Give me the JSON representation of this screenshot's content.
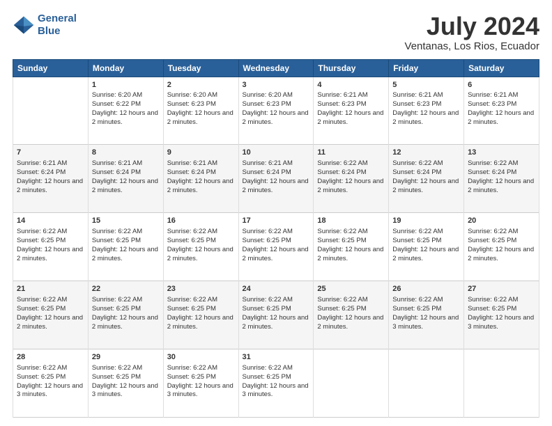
{
  "header": {
    "logo_line1": "General",
    "logo_line2": "Blue",
    "month": "July 2024",
    "location": "Ventanas, Los Rios, Ecuador"
  },
  "days_of_week": [
    "Sunday",
    "Monday",
    "Tuesday",
    "Wednesday",
    "Thursday",
    "Friday",
    "Saturday"
  ],
  "weeks": [
    [
      {
        "day": "",
        "sunrise": "",
        "sunset": "",
        "daylight": ""
      },
      {
        "day": "1",
        "sunrise": "Sunrise: 6:20 AM",
        "sunset": "Sunset: 6:22 PM",
        "daylight": "Daylight: 12 hours and 2 minutes."
      },
      {
        "day": "2",
        "sunrise": "Sunrise: 6:20 AM",
        "sunset": "Sunset: 6:23 PM",
        "daylight": "Daylight: 12 hours and 2 minutes."
      },
      {
        "day": "3",
        "sunrise": "Sunrise: 6:20 AM",
        "sunset": "Sunset: 6:23 PM",
        "daylight": "Daylight: 12 hours and 2 minutes."
      },
      {
        "day": "4",
        "sunrise": "Sunrise: 6:21 AM",
        "sunset": "Sunset: 6:23 PM",
        "daylight": "Daylight: 12 hours and 2 minutes."
      },
      {
        "day": "5",
        "sunrise": "Sunrise: 6:21 AM",
        "sunset": "Sunset: 6:23 PM",
        "daylight": "Daylight: 12 hours and 2 minutes."
      },
      {
        "day": "6",
        "sunrise": "Sunrise: 6:21 AM",
        "sunset": "Sunset: 6:23 PM",
        "daylight": "Daylight: 12 hours and 2 minutes."
      }
    ],
    [
      {
        "day": "7",
        "sunrise": "Sunrise: 6:21 AM",
        "sunset": "Sunset: 6:24 PM",
        "daylight": "Daylight: 12 hours and 2 minutes."
      },
      {
        "day": "8",
        "sunrise": "Sunrise: 6:21 AM",
        "sunset": "Sunset: 6:24 PM",
        "daylight": "Daylight: 12 hours and 2 minutes."
      },
      {
        "day": "9",
        "sunrise": "Sunrise: 6:21 AM",
        "sunset": "Sunset: 6:24 PM",
        "daylight": "Daylight: 12 hours and 2 minutes."
      },
      {
        "day": "10",
        "sunrise": "Sunrise: 6:21 AM",
        "sunset": "Sunset: 6:24 PM",
        "daylight": "Daylight: 12 hours and 2 minutes."
      },
      {
        "day": "11",
        "sunrise": "Sunrise: 6:22 AM",
        "sunset": "Sunset: 6:24 PM",
        "daylight": "Daylight: 12 hours and 2 minutes."
      },
      {
        "day": "12",
        "sunrise": "Sunrise: 6:22 AM",
        "sunset": "Sunset: 6:24 PM",
        "daylight": "Daylight: 12 hours and 2 minutes."
      },
      {
        "day": "13",
        "sunrise": "Sunrise: 6:22 AM",
        "sunset": "Sunset: 6:24 PM",
        "daylight": "Daylight: 12 hours and 2 minutes."
      }
    ],
    [
      {
        "day": "14",
        "sunrise": "Sunrise: 6:22 AM",
        "sunset": "Sunset: 6:25 PM",
        "daylight": "Daylight: 12 hours and 2 minutes."
      },
      {
        "day": "15",
        "sunrise": "Sunrise: 6:22 AM",
        "sunset": "Sunset: 6:25 PM",
        "daylight": "Daylight: 12 hours and 2 minutes."
      },
      {
        "day": "16",
        "sunrise": "Sunrise: 6:22 AM",
        "sunset": "Sunset: 6:25 PM",
        "daylight": "Daylight: 12 hours and 2 minutes."
      },
      {
        "day": "17",
        "sunrise": "Sunrise: 6:22 AM",
        "sunset": "Sunset: 6:25 PM",
        "daylight": "Daylight: 12 hours and 2 minutes."
      },
      {
        "day": "18",
        "sunrise": "Sunrise: 6:22 AM",
        "sunset": "Sunset: 6:25 PM",
        "daylight": "Daylight: 12 hours and 2 minutes."
      },
      {
        "day": "19",
        "sunrise": "Sunrise: 6:22 AM",
        "sunset": "Sunset: 6:25 PM",
        "daylight": "Daylight: 12 hours and 2 minutes."
      },
      {
        "day": "20",
        "sunrise": "Sunrise: 6:22 AM",
        "sunset": "Sunset: 6:25 PM",
        "daylight": "Daylight: 12 hours and 2 minutes."
      }
    ],
    [
      {
        "day": "21",
        "sunrise": "Sunrise: 6:22 AM",
        "sunset": "Sunset: 6:25 PM",
        "daylight": "Daylight: 12 hours and 2 minutes."
      },
      {
        "day": "22",
        "sunrise": "Sunrise: 6:22 AM",
        "sunset": "Sunset: 6:25 PM",
        "daylight": "Daylight: 12 hours and 2 minutes."
      },
      {
        "day": "23",
        "sunrise": "Sunrise: 6:22 AM",
        "sunset": "Sunset: 6:25 PM",
        "daylight": "Daylight: 12 hours and 2 minutes."
      },
      {
        "day": "24",
        "sunrise": "Sunrise: 6:22 AM",
        "sunset": "Sunset: 6:25 PM",
        "daylight": "Daylight: 12 hours and 2 minutes."
      },
      {
        "day": "25",
        "sunrise": "Sunrise: 6:22 AM",
        "sunset": "Sunset: 6:25 PM",
        "daylight": "Daylight: 12 hours and 2 minutes."
      },
      {
        "day": "26",
        "sunrise": "Sunrise: 6:22 AM",
        "sunset": "Sunset: 6:25 PM",
        "daylight": "Daylight: 12 hours and 3 minutes."
      },
      {
        "day": "27",
        "sunrise": "Sunrise: 6:22 AM",
        "sunset": "Sunset: 6:25 PM",
        "daylight": "Daylight: 12 hours and 3 minutes."
      }
    ],
    [
      {
        "day": "28",
        "sunrise": "Sunrise: 6:22 AM",
        "sunset": "Sunset: 6:25 PM",
        "daylight": "Daylight: 12 hours and 3 minutes."
      },
      {
        "day": "29",
        "sunrise": "Sunrise: 6:22 AM",
        "sunset": "Sunset: 6:25 PM",
        "daylight": "Daylight: 12 hours and 3 minutes."
      },
      {
        "day": "30",
        "sunrise": "Sunrise: 6:22 AM",
        "sunset": "Sunset: 6:25 PM",
        "daylight": "Daylight: 12 hours and 3 minutes."
      },
      {
        "day": "31",
        "sunrise": "Sunrise: 6:22 AM",
        "sunset": "Sunset: 6:25 PM",
        "daylight": "Daylight: 12 hours and 3 minutes."
      },
      {
        "day": "",
        "sunrise": "",
        "sunset": "",
        "daylight": ""
      },
      {
        "day": "",
        "sunrise": "",
        "sunset": "",
        "daylight": ""
      },
      {
        "day": "",
        "sunrise": "",
        "sunset": "",
        "daylight": ""
      }
    ]
  ]
}
